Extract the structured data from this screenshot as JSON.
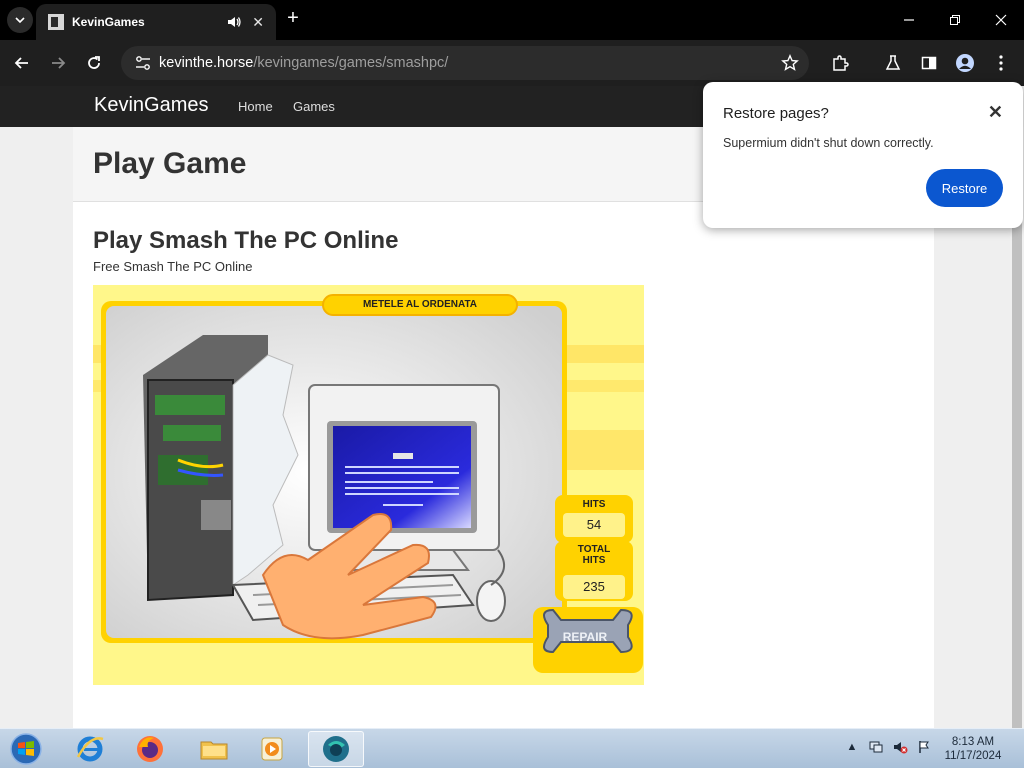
{
  "browser": {
    "tab_title": "KevinGames",
    "url_host": "kevinthe.horse",
    "url_path": "/kevingames/games/smashpc/"
  },
  "site": {
    "brand": "KevinGames",
    "nav": [
      "Home",
      "Games"
    ],
    "page_title": "Play Game",
    "game_title": "Play Smash The PC Online",
    "game_subtitle": "Free Smash The PC Online"
  },
  "game": {
    "banner": "METELE AL ORDENATA",
    "hits_label": "HITS",
    "hits_value": "54",
    "total_hits_label": "TOTAL HITS",
    "total_hits_value": "235",
    "repair_label": "REPAIR"
  },
  "popup": {
    "title": "Restore pages?",
    "message": "Supermium didn't shut down correctly.",
    "button": "Restore"
  },
  "taskbar": {
    "time": "8:13 AM",
    "date": "11/17/2024"
  }
}
